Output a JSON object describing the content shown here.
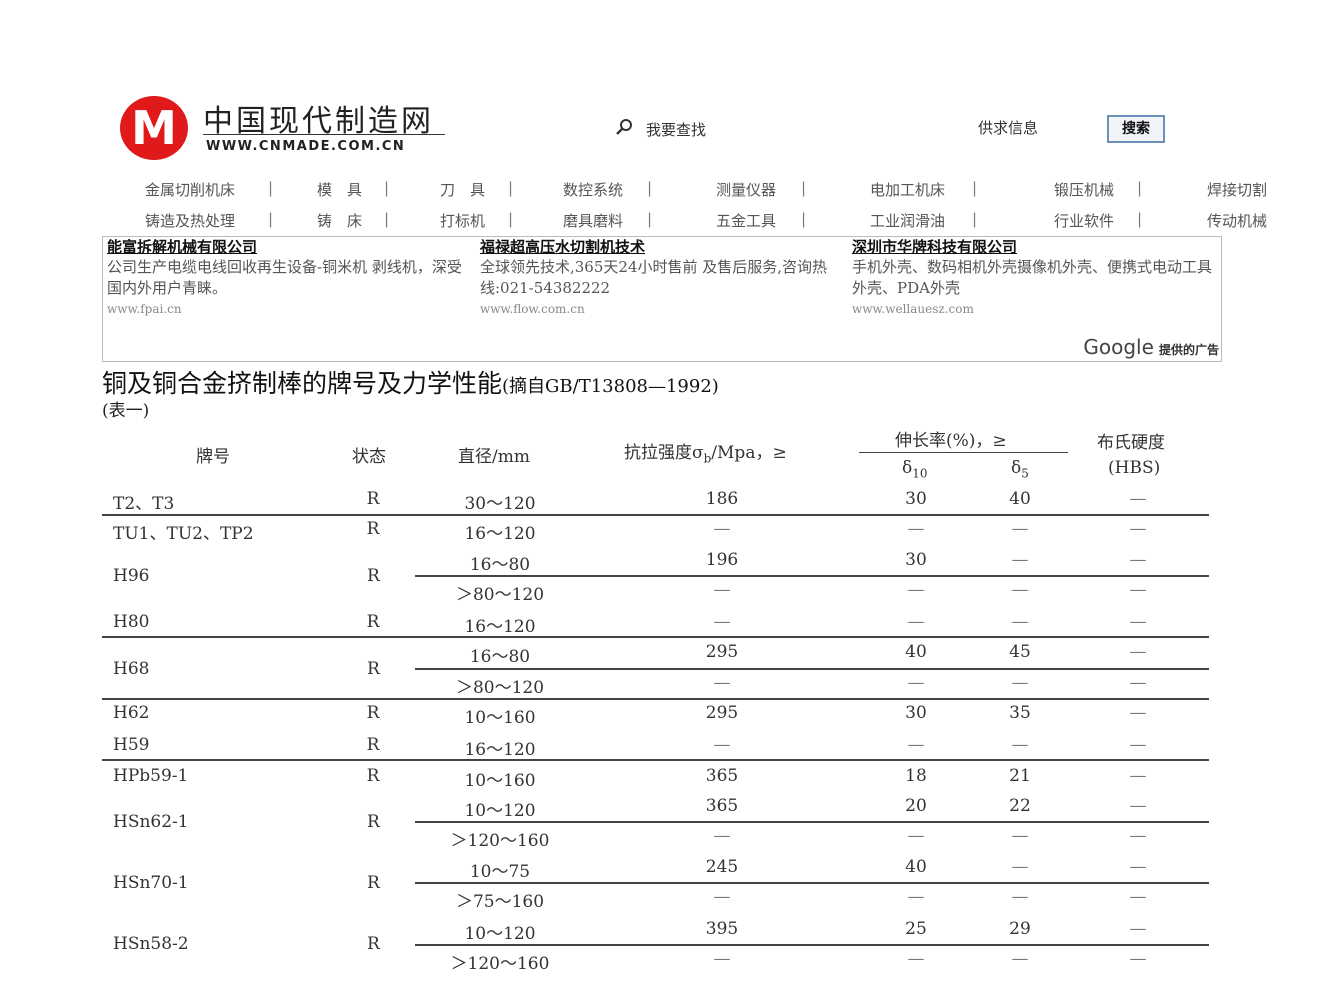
{
  "header": {
    "logo_letter": "M",
    "site_name": "中国现代制造网",
    "site_url": "WWW.CNMADE.COM.CN",
    "search_label": "我要查找",
    "supply_label": "供求信息",
    "search_button": "搜索"
  },
  "nav": {
    "row1": [
      "金属切削机床",
      "模　具",
      "刀　具",
      "数控系统",
      "测量仪器",
      "电加工机床",
      "锻压机械",
      "焊接切割"
    ],
    "row2": [
      "铸造及热处理",
      "铸　床",
      "打标机",
      "磨具磨料",
      "五金工具",
      "工业润滑油",
      "行业软件",
      "传动机械"
    ]
  },
  "ads": [
    {
      "title": "能富拆解机械有限公司",
      "text": "公司生产电缆电线回收再生设备-铜米机 剥线机，深受国内外用户青睐。",
      "url": "www.fpai.cn"
    },
    {
      "title": "福禄超高压水切割机技术",
      "text": "全球领先技术,365天24小时售前 及售后服务,咨询热线:021-54382222",
      "url": "www.flow.com.cn"
    },
    {
      "title": "深圳市华牌科技有限公司",
      "text": "手机外壳、数码相机外壳摄像机外壳、便携式电动工具外壳、PDA外壳",
      "url": "www.wellauesz.com"
    }
  ],
  "ads_badge": {
    "brand": "Google",
    "note": "提供的广告"
  },
  "article": {
    "title": "铜及铜合金挤制棒的牌号及力学性能",
    "source": "(摘自GB/T13808—1992)",
    "caption": "(表一)"
  },
  "table": {
    "headers": {
      "grade": "牌号",
      "state": "状态",
      "diameter": "直径/mm",
      "tensile": "抗拉强度σ",
      "tensile_sub": "b",
      "tensile_unit": "/Mpa，≥",
      "elongation": "伸长率(%)，≥",
      "delta": "δ",
      "delta10": "10",
      "delta5": "5",
      "hardness": "布氏硬度",
      "hardness_unit": "(HBS)"
    },
    "rows": [
      {
        "grade": "T2、T3",
        "state": "R",
        "diameter": "30～120",
        "tensile": "186",
        "d10": "30",
        "d5": "40",
        "hbs": "—"
      },
      {
        "grade": "TU1、TU2、TP2",
        "state": "R",
        "diameter": "16～120",
        "tensile": "—",
        "d10": "—",
        "d5": "—",
        "hbs": "—"
      },
      {
        "grade": "",
        "state": "",
        "diameter": "16～80",
        "tensile": "196",
        "d10": "30",
        "d5": "—",
        "hbs": "—"
      },
      {
        "grade": "",
        "state": "",
        "diameter": "＞80～120",
        "tensile": "—",
        "d10": "—",
        "d5": "—",
        "hbs": "—"
      },
      {
        "grade": "H80",
        "state": "R",
        "diameter": "16～120",
        "tensile": "—",
        "d10": "—",
        "d5": "—",
        "hbs": "—"
      },
      {
        "grade": "",
        "state": "",
        "diameter": "16～80",
        "tensile": "295",
        "d10": "40",
        "d5": "45",
        "hbs": "—"
      },
      {
        "grade": "",
        "state": "",
        "diameter": "＞80～120",
        "tensile": "—",
        "d10": "—",
        "d5": "—",
        "hbs": "—"
      },
      {
        "grade": "H62",
        "state": "R",
        "diameter": "10～160",
        "tensile": "295",
        "d10": "30",
        "d5": "35",
        "hbs": "—"
      },
      {
        "grade": "H59",
        "state": "R",
        "diameter": "16～120",
        "tensile": "—",
        "d10": "—",
        "d5": "—",
        "hbs": "—"
      },
      {
        "grade": "HPb59-1",
        "state": "R",
        "diameter": "10～160",
        "tensile": "365",
        "d10": "18",
        "d5": "21",
        "hbs": "—"
      },
      {
        "grade": "",
        "state": "",
        "diameter": "10～120",
        "tensile": "365",
        "d10": "20",
        "d5": "22",
        "hbs": "—"
      },
      {
        "grade": "",
        "state": "",
        "diameter": "＞120～160",
        "tensile": "—",
        "d10": "—",
        "d5": "—",
        "hbs": "—"
      },
      {
        "grade": "",
        "state": "",
        "diameter": "10～75",
        "tensile": "245",
        "d10": "40",
        "d5": "—",
        "hbs": "—"
      },
      {
        "grade": "",
        "state": "",
        "diameter": "＞75～160",
        "tensile": "—",
        "d10": "—",
        "d5": "—",
        "hbs": "—"
      },
      {
        "grade": "",
        "state": "",
        "diameter": "10～120",
        "tensile": "395",
        "d10": "25",
        "d5": "29",
        "hbs": "—"
      },
      {
        "grade": "",
        "state": "",
        "diameter": "＞120～160",
        "tensile": "—",
        "d10": "—",
        "d5": "—",
        "hbs": "—"
      }
    ],
    "merged": [
      {
        "grade": "H96",
        "state": "R"
      },
      {
        "grade": "H68",
        "state": "R"
      },
      {
        "grade": "HSn62-1",
        "state": "R"
      },
      {
        "grade": "HSn70-1",
        "state": "R"
      },
      {
        "grade": "HSn58-2",
        "state": "R"
      }
    ]
  }
}
